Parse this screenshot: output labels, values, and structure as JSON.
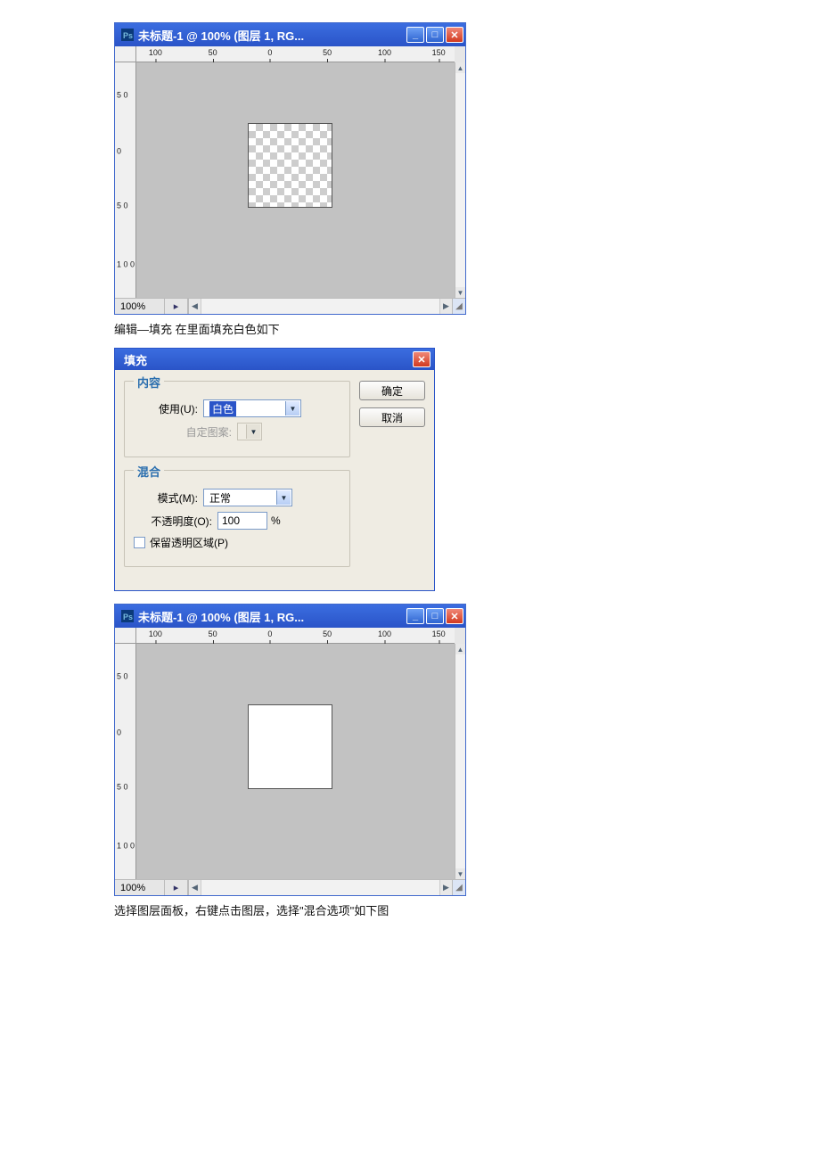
{
  "win1": {
    "title": "未标题-1 @ 100% (图层 1, RG...",
    "zoom": "100%",
    "ruler_h": [
      "100",
      "50",
      "0",
      "50",
      "100",
      "150"
    ],
    "ruler_v": [
      "5\n0",
      "0",
      "5\n0",
      "1\n0\n0"
    ]
  },
  "caption1": "编辑—填充       在里面填充白色如下",
  "fill_dialog": {
    "title": "填充",
    "group_content": "内容",
    "use_label": "使用(U):",
    "use_value": "白色",
    "custom_pattern_label": "自定图案:",
    "group_blend": "混合",
    "mode_label": "模式(M):",
    "mode_value": "正常",
    "opacity_label": "不透明度(O):",
    "opacity_value": "100",
    "opacity_unit": "%",
    "preserve_label": "保留透明区域(P)",
    "ok": "确定",
    "cancel": "取消"
  },
  "win2": {
    "title": "未标题-1 @ 100% (图层 1, RG...",
    "zoom": "100%",
    "ruler_h": [
      "100",
      "50",
      "0",
      "50",
      "100",
      "150"
    ],
    "ruler_v": [
      "5\n0",
      "0",
      "5\n0",
      "1\n0\n0"
    ]
  },
  "caption2": "选择图层面板，右键点击图层，选择\"混合选项\"如下图"
}
